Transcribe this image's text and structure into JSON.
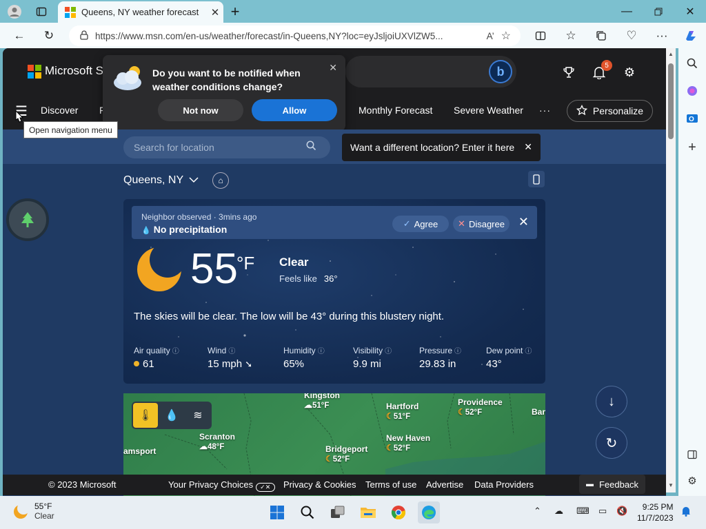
{
  "browser": {
    "tab_title": "Queens, NY weather forecast | M",
    "url": "https://www.msn.com/en-us/weather/forecast/in-Queens,NY?loc=eyJsljoiUXVlZW5...",
    "read_aloud_label": "A’"
  },
  "header": {
    "brand": "Microsoft St",
    "notification_count": "5"
  },
  "nav": {
    "items": [
      "Discover",
      "F",
      "Monthly Forecast",
      "Severe Weather",
      "···"
    ],
    "personalize": "Personalize",
    "tooltip": "Open navigation menu"
  },
  "notify_popup": {
    "text": "Do you want to be notified when weather conditions change?",
    "not_now": "Not now",
    "allow": "Allow"
  },
  "search": {
    "placeholder": "Search for location",
    "tip": "Want a different location? Enter it here"
  },
  "location": {
    "name": "Queens, NY"
  },
  "observation": {
    "title": "Neighbor observed · 3mins ago",
    "main": "No precipitation",
    "agree": "Agree",
    "disagree": "Disagree"
  },
  "current": {
    "temp": "55",
    "unit": "°F",
    "condition": "Clear",
    "feels_label": "Feels like",
    "feels_value": "36°",
    "summary": "The skies will be clear. The low will be 43° during this blustery night."
  },
  "metrics": [
    {
      "label": "Air quality",
      "value": "61"
    },
    {
      "label": "Wind",
      "value": "15 mph"
    },
    {
      "label": "Humidity",
      "value": "65%"
    },
    {
      "label": "Visibility",
      "value": "9.9 mi"
    },
    {
      "label": "Pressure",
      "value": "29.83 in"
    },
    {
      "label": "Dew point",
      "value": "43°"
    }
  ],
  "map": {
    "cities": [
      {
        "name": "Kingston",
        "temp": "51°F"
      },
      {
        "name": "Hartford",
        "temp": "51°F"
      },
      {
        "name": "Providence",
        "temp": "52°F"
      },
      {
        "name": "Ban",
        "temp": ""
      },
      {
        "name": "Scranton",
        "temp": "48°F"
      },
      {
        "name": "amsport",
        "temp": ""
      },
      {
        "name": "Bridgeport",
        "temp": "52°F"
      },
      {
        "name": "New Haven",
        "temp": "52°F"
      }
    ]
  },
  "footer": {
    "copyright": "© 2023 Microsoft",
    "privacy_choices": "Your Privacy Choices",
    "privacy_cookies": "Privacy & Cookies",
    "terms": "Terms of use",
    "advertise": "Advertise",
    "data_providers": "Data Providers",
    "feedback": "Feedback"
  },
  "taskbar": {
    "weather_temp": "55°F",
    "weather_cond": "Clear",
    "time": "9:25 PM",
    "date": "11/7/2023"
  },
  "colors": {
    "accent": "#1a73d6",
    "page_bg": "#1f3a63",
    "header_bg": "#1d1d1f",
    "map_green": "#3b8e53",
    "moon": "#f2a521"
  }
}
